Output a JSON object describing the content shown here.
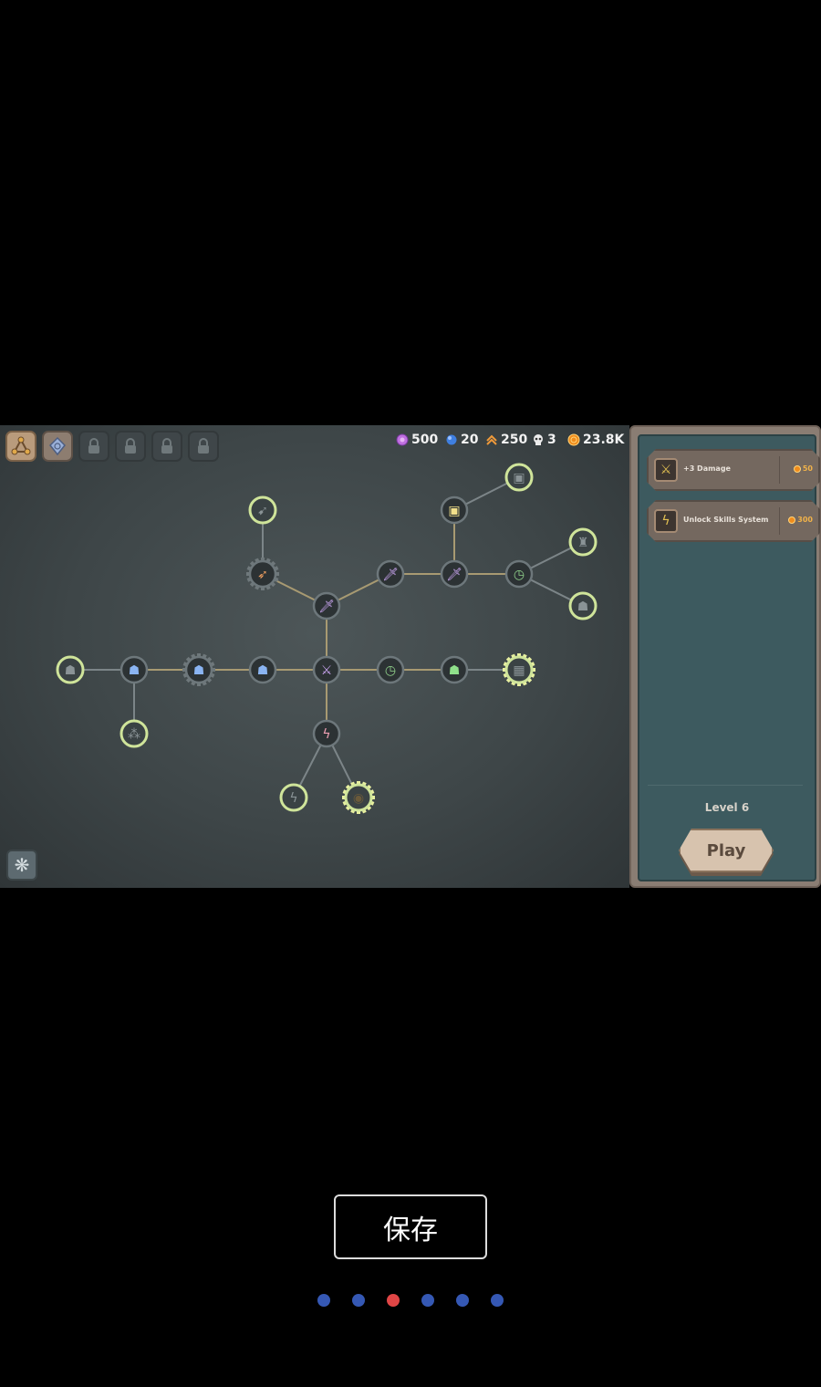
{
  "tabs": [
    {
      "name": "tab-skill-tree",
      "icon": "tree-icon",
      "state": "active"
    },
    {
      "name": "tab-gem",
      "icon": "gem-icon",
      "state": "selected"
    },
    {
      "name": "tab-locked-1",
      "icon": "lock-icon",
      "state": "locked"
    },
    {
      "name": "tab-locked-2",
      "icon": "lock-icon",
      "state": "locked"
    },
    {
      "name": "tab-locked-3",
      "icon": "lock-icon",
      "state": "locked"
    },
    {
      "name": "tab-locked-4",
      "icon": "lock-icon",
      "state": "locked"
    }
  ],
  "resources": {
    "gems": "500",
    "orbs": "20",
    "rank": "250",
    "skulls": "3",
    "coins": "23.8K"
  },
  "panel": {
    "upgrades": [
      {
        "title": "+3 Damage",
        "cost": "50",
        "icon": "sword-icon"
      },
      {
        "title": "Unlock Skills System",
        "cost": "300",
        "icon": "lightning-icon"
      }
    ],
    "level_label": "Level 6",
    "play_label": "Play"
  },
  "footer": {
    "save_label": "保存",
    "pager": {
      "total": 6,
      "active_index": 2
    }
  },
  "colors": {
    "node_unlocked_ring": "#cfe49a",
    "node_locked_ring": "#6d777b",
    "link": "#a89a72",
    "dot_inactive": "#3558b4",
    "dot_active": "#e04646"
  },
  "nodes": [
    {
      "id": "n-root",
      "icon": "crossed-swords-icon",
      "ring": "dark",
      "glyph": "⚔",
      "color": "#c9a4f0"
    },
    {
      "id": "n-sword-mid",
      "icon": "sword-icon",
      "ring": "dark",
      "glyph": "🗡",
      "color": "#c9a4f0"
    },
    {
      "id": "n-fire",
      "icon": "fire-arrow-icon",
      "ring": "gear",
      "glyph": "➶",
      "color": "#f2a060"
    },
    {
      "id": "n-arrow-up",
      "icon": "arrows-icon",
      "ring": "green",
      "glyph": "➹",
      "color": "#8a9396"
    },
    {
      "id": "n-sword-r1",
      "icon": "sword-icon",
      "ring": "dark",
      "glyph": "🗡",
      "color": "#c9a4f0"
    },
    {
      "id": "n-sword-r2",
      "icon": "sword-icon",
      "ring": "dark",
      "glyph": "🗡",
      "color": "#c9a4f0"
    },
    {
      "id": "n-chest",
      "icon": "chest-icon",
      "ring": "dark",
      "glyph": "▣",
      "color": "#f2e08a"
    },
    {
      "id": "n-chest-top",
      "icon": "chest-icon",
      "ring": "green",
      "glyph": "▣",
      "color": "#8a9396"
    },
    {
      "id": "n-clock-speed",
      "icon": "clock-icon",
      "ring": "dark",
      "glyph": "◷",
      "color": "#8fd08a"
    },
    {
      "id": "n-money-bag",
      "icon": "money-bag-icon",
      "ring": "green",
      "glyph": "♜",
      "color": "#8a9396"
    },
    {
      "id": "n-cat-top",
      "icon": "cat-icon",
      "ring": "green",
      "glyph": "☗",
      "color": "#8a9396"
    },
    {
      "id": "n-cat-blue-3",
      "icon": "cat-icon",
      "ring": "dark",
      "glyph": "☗",
      "color": "#8ab4f2"
    },
    {
      "id": "n-cat-blue-2",
      "icon": "cat-icon",
      "ring": "gear",
      "glyph": "☗",
      "color": "#8ab4f2"
    },
    {
      "id": "n-cat-blue-1",
      "icon": "cat-icon",
      "ring": "dark",
      "glyph": "☗",
      "color": "#8ab4f2"
    },
    {
      "id": "n-cat-left",
      "icon": "cat-icon",
      "ring": "green",
      "glyph": "☗",
      "color": "#8a9396"
    },
    {
      "id": "n-stars",
      "icon": "stars-icon",
      "ring": "green",
      "glyph": "⁂",
      "color": "#8a9396"
    },
    {
      "id": "n-clock",
      "icon": "clock-icon",
      "ring": "dark",
      "glyph": "◷",
      "color": "#8fd08a"
    },
    {
      "id": "n-cat-green",
      "icon": "cat-icon",
      "ring": "dark",
      "glyph": "☗",
      "color": "#8fe08a"
    },
    {
      "id": "n-frame",
      "icon": "frame-icon",
      "ring": "gear-green",
      "glyph": "▦",
      "color": "#8a9396"
    },
    {
      "id": "n-lightning",
      "icon": "lightning-icon",
      "ring": "dark",
      "glyph": "ϟ",
      "color": "#f0a0b4"
    },
    {
      "id": "n-bolt-small",
      "icon": "bolt-icon",
      "ring": "green",
      "glyph": "ϟ",
      "color": "#8a9396"
    },
    {
      "id": "n-spiral",
      "icon": "spiral-icon",
      "ring": "gear-green",
      "glyph": "◉",
      "color": "#6b5a3a"
    }
  ]
}
